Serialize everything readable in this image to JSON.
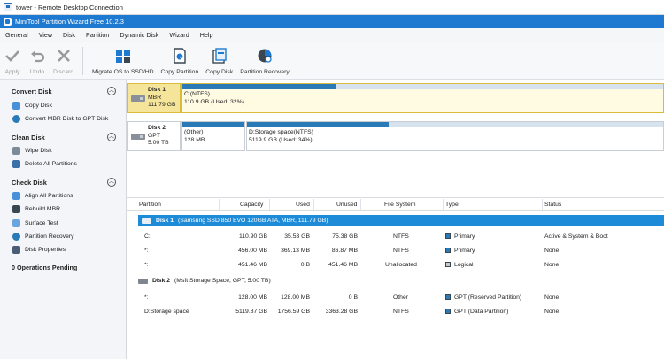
{
  "rdp": {
    "title": "tower - Remote Desktop Connection"
  },
  "app": {
    "title": "MiniTool Partition Wizard Free 10.2.3"
  },
  "menu": [
    "General",
    "View",
    "Disk",
    "Partition",
    "Dynamic Disk",
    "Wizard",
    "Help"
  ],
  "toolbar": {
    "apply": "Apply",
    "undo": "Undo",
    "discard": "Discard",
    "migrate": "Migrate OS to SSD/HD",
    "copy_partition": "Copy Partition",
    "copy_disk": "Copy Disk",
    "partition_recovery": "Partition Recovery"
  },
  "left": {
    "convert_disk": {
      "title": "Convert Disk",
      "items": [
        "Copy Disk",
        "Convert MBR Disk to GPT Disk"
      ]
    },
    "clean_disk": {
      "title": "Clean Disk",
      "items": [
        "Wipe Disk",
        "Delete All Partitions"
      ]
    },
    "check_disk": {
      "title": "Check Disk",
      "items": [
        "Align All Partitions",
        "Rebuild MBR",
        "Surface Test",
        "Partition Recovery",
        "Disk Properties"
      ]
    },
    "pending": "0 Operations Pending"
  },
  "disk_map": [
    {
      "name": "Disk 1",
      "style": "MBR",
      "size": "111.79 GB",
      "partitions": [
        {
          "label": "C:(NTFS)",
          "detail": "110.9 GB (Used: 32%)",
          "used_fraction": 0.32
        }
      ]
    },
    {
      "name": "Disk 2",
      "style": "GPT",
      "size": "5.00 TB",
      "partitions": [
        {
          "label": "(Other)",
          "detail": "128 MB",
          "used_fraction": 1.0
        },
        {
          "label": "D:Storage space(NTFS)",
          "detail": "5119.9 GB (Used: 34%)",
          "used_fraction": 0.34
        }
      ]
    }
  ],
  "grid": {
    "headers": [
      "Partition",
      "Capacity",
      "Used",
      "Unused",
      "File System",
      "Type",
      "Status"
    ],
    "disk1": {
      "name": "Disk 1",
      "desc": "(Samsung SSD 850 EVO 120GB ATA, MBR, 111.79 GB)"
    },
    "disk1_rows": [
      {
        "partition": "C:",
        "capacity": "110.90 GB",
        "used": "35.53 GB",
        "unused": "75.38 GB",
        "fs": "NTFS",
        "type": "Primary",
        "status": "Active & System & Boot",
        "type_color": "#2b7ab8"
      },
      {
        "partition": "*:",
        "capacity": "456.00 MB",
        "used": "369.13 MB",
        "unused": "86.87 MB",
        "fs": "NTFS",
        "type": "Primary",
        "status": "None",
        "type_color": "#2b7ab8"
      },
      {
        "partition": "*:",
        "capacity": "451.46 MB",
        "used": "0 B",
        "unused": "451.46 MB",
        "fs": "Unallocated",
        "type": "Logical",
        "status": "None",
        "type_color": "#c8c8c8"
      }
    ],
    "disk2": {
      "name": "Disk 2",
      "desc": "(Msft Storage Space, GPT, 5.00 TB)"
    },
    "disk2_rows": [
      {
        "partition": "*:",
        "capacity": "128.00 MB",
        "used": "128.00 MB",
        "unused": "0 B",
        "fs": "Other",
        "type": "GPT (Reserved Partition)",
        "status": "None",
        "type_color": "#2b7ab8"
      },
      {
        "partition": "D:Storage space",
        "capacity": "5119.87 GB",
        "used": "1756.59 GB",
        "unused": "3363.28 GB",
        "fs": "NTFS",
        "type": "GPT (Data Partition)",
        "status": "None",
        "type_color": "#2b7ab8"
      }
    ]
  }
}
